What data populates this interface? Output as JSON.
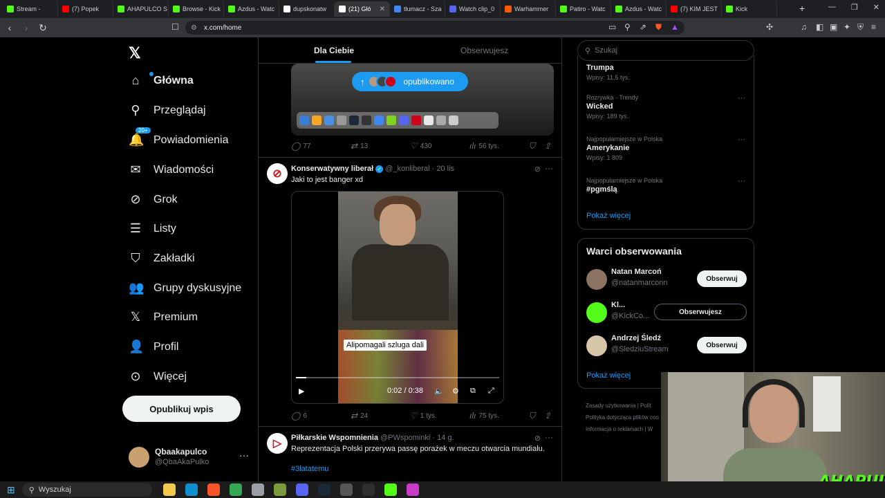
{
  "browser": {
    "tabs": [
      {
        "label": "Stream - ",
        "color": "#53fc18"
      },
      {
        "label": "(7) Popek",
        "color": "#ff0000"
      },
      {
        "label": "AHAPULCO S",
        "color": "#53fc18"
      },
      {
        "label": "Browse - Kick",
        "color": "#53fc18"
      },
      {
        "label": "Azdus - Watc",
        "color": "#53fc18"
      },
      {
        "label": "dupskonatw",
        "color": "#ffffff"
      },
      {
        "label": "(21) Głó",
        "color": "#ffffff",
        "active": true
      },
      {
        "label": "tłumacz - Sza",
        "color": "#4285f4"
      },
      {
        "label": "Watch clip_0",
        "color": "#5865f2"
      },
      {
        "label": "Warhammer",
        "color": "#ff5a00"
      },
      {
        "label": "Patiro - Watc",
        "color": "#53fc18"
      },
      {
        "label": "Azdus - Watc",
        "color": "#53fc18"
      },
      {
        "label": "(7) KIM JEST",
        "color": "#ff0000"
      },
      {
        "label": "Kick",
        "color": "#53fc18"
      }
    ],
    "url": "x.com/home"
  },
  "nav": {
    "items": [
      {
        "label": "Główna",
        "icon": "home-icon",
        "glyph": "⌂",
        "active": true
      },
      {
        "label": "Przeglądaj",
        "icon": "search-icon",
        "glyph": "⚲"
      },
      {
        "label": "Powiadomienia",
        "icon": "bell-icon",
        "glyph": "🔔",
        "badge": "20+"
      },
      {
        "label": "Wiadomości",
        "icon": "mail-icon",
        "glyph": "✉"
      },
      {
        "label": "Grok",
        "icon": "grok-icon",
        "glyph": "⊘"
      },
      {
        "label": "Listy",
        "icon": "list-icon",
        "glyph": "☰"
      },
      {
        "label": "Zakładki",
        "icon": "bookmark-icon",
        "glyph": "⛉"
      },
      {
        "label": "Grupy dyskusyjne",
        "icon": "communities-icon",
        "glyph": "👥"
      },
      {
        "label": "Premium",
        "icon": "x-premium-icon",
        "glyph": "𝕏"
      },
      {
        "label": "Profil",
        "icon": "profile-icon",
        "glyph": "👤"
      },
      {
        "label": "Więcej",
        "icon": "more-circle-icon",
        "glyph": "⊙"
      }
    ],
    "post_button": "Opublikuj wpis",
    "profile": {
      "name": "Qbaakapulco",
      "handle": "@QbaAkaPulko"
    }
  },
  "timeline": {
    "tabs": [
      "Dla Ciebie",
      "Obserwujesz"
    ],
    "new_posts_label": "opublikowano",
    "post0_actions": {
      "replies": "77",
      "reposts": "13",
      "likes": "430",
      "views": "56 tys."
    },
    "post1": {
      "name": "Konserwatywny liberał",
      "handle": "@_konliberal",
      "time": "· 20 lis",
      "text": "Jaki to jest banger xd",
      "video_caption": "Alipomagali szluga dali",
      "video_time": "0:02 / 0:38",
      "progress": 0.05,
      "actions": {
        "replies": "6",
        "reposts": "24",
        "likes": "1 tys.",
        "views": "75 tys."
      }
    },
    "post2": {
      "name": "Piłkarskie Wspomnienia",
      "handle": "@PWspominki",
      "time": "· 14 g.",
      "text": "Reprezentacja Polski przerywa passę porażek w meczu otwarcia mundialu.",
      "hashtag": "#3latatemu"
    }
  },
  "sidebar": {
    "search_placeholder": "Szukaj",
    "trends": [
      {
        "context": "",
        "title": "Trumpa",
        "count": "Wpisy: 11,5 tys."
      },
      {
        "context": "Rozrywka · Trendy",
        "title": "Wicked",
        "count": "Wpisy: 189 tys."
      },
      {
        "context": "Najpopularniejsze w Polska",
        "title": "Amerykanie",
        "count": "Wpisy: 1 809"
      },
      {
        "context": "Najpopularniejsze w Polska",
        "title": "#pgmślą",
        "count": ""
      }
    ],
    "show_more": "Pokaż więcej",
    "who_to_follow": {
      "title": "Warci obserwowania",
      "accounts": [
        {
          "name": "Natan Marcoń",
          "handle": "@natanmarconn",
          "button": "Obserwuj",
          "following": false,
          "color": "#8a7360"
        },
        {
          "name": "Kl...",
          "handle": "@KickCo...",
          "button": "Obserwujesz",
          "following": true,
          "color": "#53fc18"
        },
        {
          "name": "Andrzej Śledź",
          "handle": "@SledziuStream",
          "button": "Obserwuj",
          "following": false,
          "color": "#d8c6a8"
        }
      ],
      "show_more": "Pokaż więcej"
    },
    "footer": [
      "Zasady użytkowania  |  Polit",
      "Polityka dotycząca plików coo",
      "Informacja o reklamach  |  W"
    ]
  },
  "stream": {
    "logo": "AHAPULCO"
  },
  "taskbar": {
    "search": "Wyszukaj"
  }
}
